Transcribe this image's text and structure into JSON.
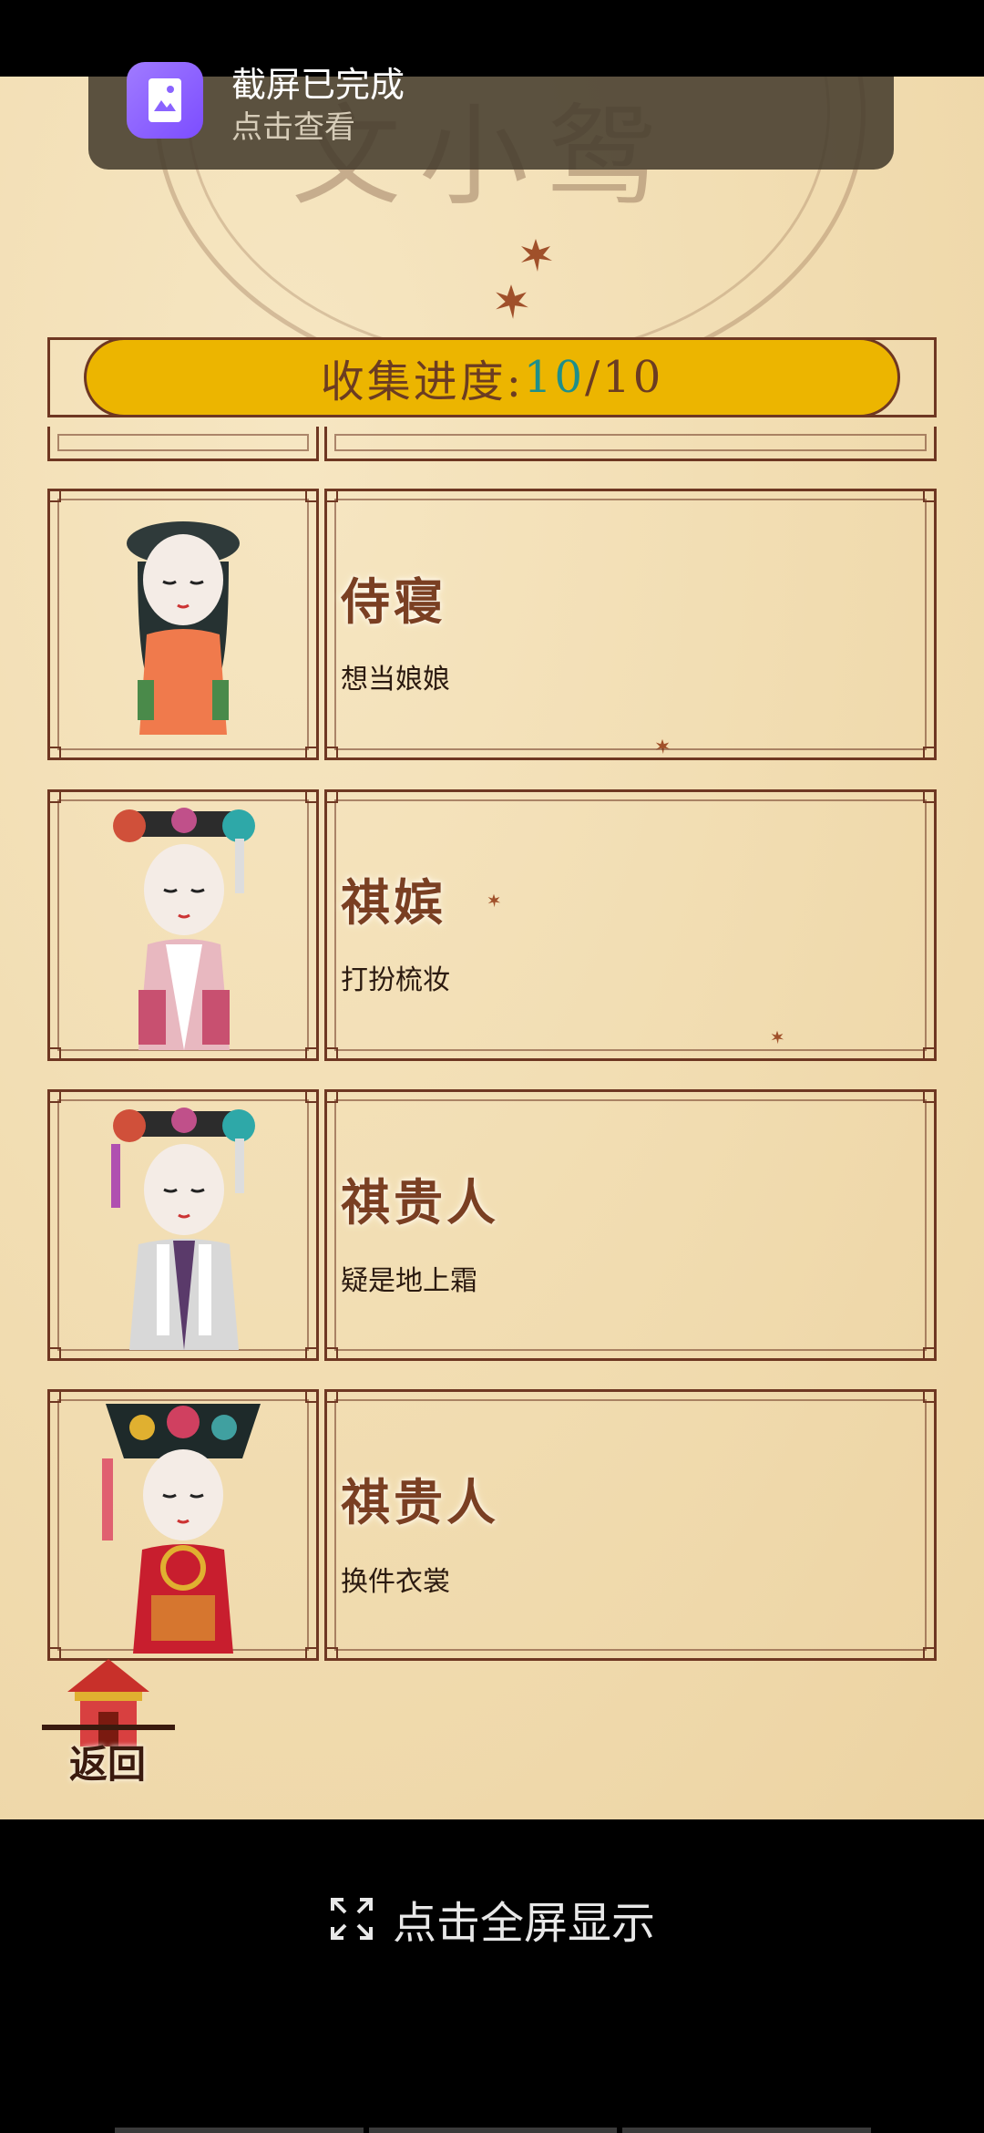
{
  "notification": {
    "title": "截屏已完成",
    "subtitle": "点击查看"
  },
  "background_title": "文小鸳",
  "progress": {
    "label": "收集进度:",
    "current": "10",
    "separator": "/",
    "total": "10"
  },
  "cards": [
    {
      "name": "侍寝",
      "desc": "想当娘娘"
    },
    {
      "name": "祺嫔",
      "desc": "打扮梳妆"
    },
    {
      "name": "祺贵人",
      "desc": "疑是地上霜"
    },
    {
      "name": "祺贵人",
      "desc": "换件衣裳"
    }
  ],
  "back_button": {
    "label": "返回"
  },
  "fullscreen_hint": {
    "label": "点击全屏显示"
  },
  "colors": {
    "accent": "#ecb500",
    "frame": "#6e3722",
    "parchment": "#f1dcb0",
    "progress_current": "#1e8f8a"
  }
}
